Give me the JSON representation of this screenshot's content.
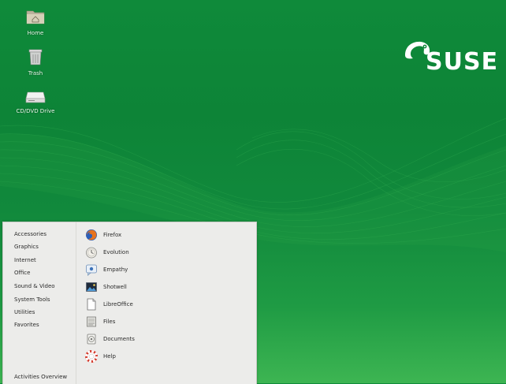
{
  "desktop": {
    "icons": [
      {
        "label": "Home",
        "icon": "home-folder-icon"
      },
      {
        "label": "Trash",
        "icon": "trash-icon"
      },
      {
        "label": "CD/DVD Drive",
        "icon": "cd-dvd-drive-icon"
      }
    ],
    "brand": "SUSE"
  },
  "menu": {
    "categories": [
      "Accessories",
      "Graphics",
      "Internet",
      "Office",
      "Sound & Video",
      "System Tools",
      "Utilities",
      "Favorites"
    ],
    "overview": "Activities Overview",
    "apps": [
      {
        "name": "Firefox",
        "icon": "firefox-icon"
      },
      {
        "name": "Evolution",
        "icon": "evolution-icon"
      },
      {
        "name": "Empathy",
        "icon": "empathy-icon"
      },
      {
        "name": "Shotwell",
        "icon": "shotwell-icon"
      },
      {
        "name": "LibreOffice",
        "icon": "libreoffice-icon"
      },
      {
        "name": "Files",
        "icon": "files-icon"
      },
      {
        "name": "Documents",
        "icon": "documents-icon"
      },
      {
        "name": "Help",
        "icon": "help-icon"
      }
    ]
  },
  "colors": {
    "background": "#0f8a3a",
    "menu": "#ececea",
    "accent_light": "#3db552"
  }
}
